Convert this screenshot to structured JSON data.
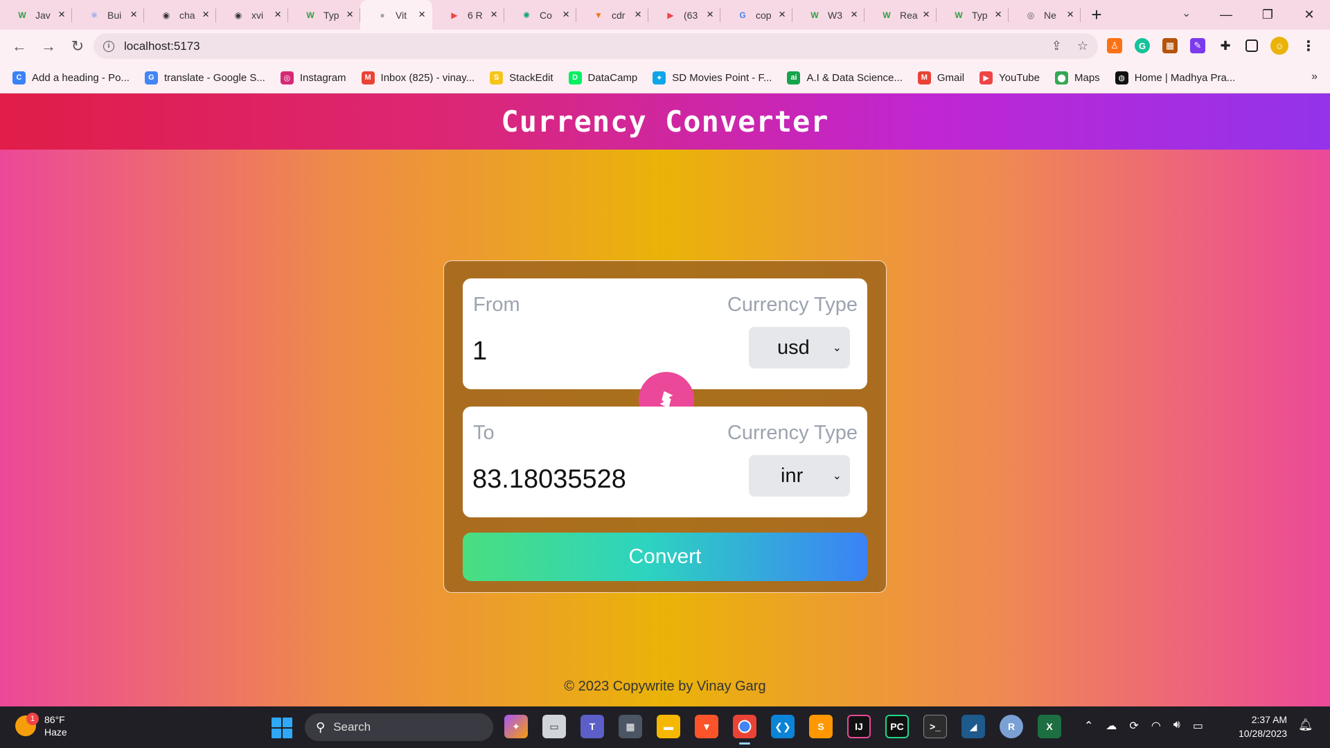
{
  "browser": {
    "tabs": [
      {
        "title": "Jav",
        "icon": "wikipedia-icon",
        "fav_text": "W",
        "color": "#2f9e44",
        "active": false
      },
      {
        "title": "Bui",
        "icon": "react-icon",
        "fav_text": "⚛",
        "color": "#3b82f6",
        "active": false
      },
      {
        "title": "cha",
        "icon": "github-icon",
        "fav_text": "◉",
        "color": "#333333",
        "active": false
      },
      {
        "title": "xvi",
        "icon": "github-icon",
        "fav_text": "◉",
        "color": "#333333",
        "active": false
      },
      {
        "title": "Typ",
        "icon": "wikipedia-icon",
        "fav_text": "W",
        "color": "#2f9e44",
        "active": false
      },
      {
        "title": "Vit",
        "icon": "globe-icon",
        "fav_text": "●",
        "color": "#9ca3af",
        "active": true
      },
      {
        "title": "6 R",
        "icon": "youtube-icon",
        "fav_text": "▶",
        "color": "#ef4444",
        "active": false
      },
      {
        "title": "Co",
        "icon": "chatgpt-icon",
        "fav_text": "✺",
        "color": "#10a37f",
        "active": false
      },
      {
        "title": "cdr",
        "icon": "brave-icon",
        "fav_text": "▼",
        "color": "#f97316",
        "active": false
      },
      {
        "title": "(63",
        "icon": "youtube-icon",
        "fav_text": "▶",
        "color": "#ef4444",
        "active": false
      },
      {
        "title": "cop",
        "icon": "google-icon",
        "fav_text": "G",
        "color": "#4285f4",
        "active": false
      },
      {
        "title": "W3",
        "icon": "wikipedia-icon",
        "fav_text": "W",
        "color": "#2f9e44",
        "active": false
      },
      {
        "title": "Rea",
        "icon": "wikipedia-icon",
        "fav_text": "W",
        "color": "#2f9e44",
        "active": false
      },
      {
        "title": "Typ",
        "icon": "wikipedia-icon",
        "fav_text": "W",
        "color": "#2f9e44",
        "active": false
      },
      {
        "title": "Ne",
        "icon": "chrome-icon",
        "fav_text": "◎",
        "color": "#555555",
        "active": false
      }
    ],
    "url": "localhost:5173",
    "bookmarks": [
      {
        "label": "Add a heading - Po...",
        "icon": "canva-icon",
        "fav_text": "C",
        "color": "#3b82f6"
      },
      {
        "label": "translate - Google S...",
        "icon": "google-icon",
        "fav_text": "G",
        "color": "#4285f4"
      },
      {
        "label": "Instagram",
        "icon": "instagram-icon",
        "fav_text": "◎",
        "color": "#d62976"
      },
      {
        "label": "Inbox (825) - vinay...",
        "icon": "gmail-icon",
        "fav_text": "M",
        "color": "#ea4335"
      },
      {
        "label": "StackEdit",
        "icon": "stackedit-icon",
        "fav_text": "S",
        "color": "#f5c518"
      },
      {
        "label": "DataCamp",
        "icon": "datacamp-icon",
        "fav_text": "D",
        "color": "#03ef62"
      },
      {
        "label": "SD Movies Point - F...",
        "icon": "sd-movies-icon",
        "fav_text": "✦",
        "color": "#0ea5e9"
      },
      {
        "label": "A.I & Data Science...",
        "icon": "ai-icon",
        "fav_text": "ai",
        "color": "#16a34a"
      },
      {
        "label": "Gmail",
        "icon": "gmail-icon",
        "fav_text": "M",
        "color": "#ea4335"
      },
      {
        "label": "YouTube",
        "icon": "youtube-icon",
        "fav_text": "▶",
        "color": "#ef4444"
      },
      {
        "label": "Maps",
        "icon": "maps-icon",
        "fav_text": "⬤",
        "color": "#34a853"
      },
      {
        "label": "Home | Madhya Pra...",
        "icon": "globe-icon",
        "fav_text": "◍",
        "color": "#111111"
      }
    ]
  },
  "app": {
    "title": "Currency Converter",
    "from": {
      "label": "From",
      "currency_type_label": "Currency Type",
      "amount": "1",
      "currency": "usd"
    },
    "to": {
      "label": "To",
      "currency_type_label": "Currency Type",
      "amount": "83.18035528",
      "currency": "inr"
    },
    "convert_label": "Convert",
    "footer": "© 2023 Copywrite by Vinay Garg"
  },
  "taskbar": {
    "weather_temp": "86°F",
    "weather_desc": "Haze",
    "weather_badge": "1",
    "search_label": "Search",
    "time": "2:37 AM",
    "date": "10/28/2023"
  }
}
